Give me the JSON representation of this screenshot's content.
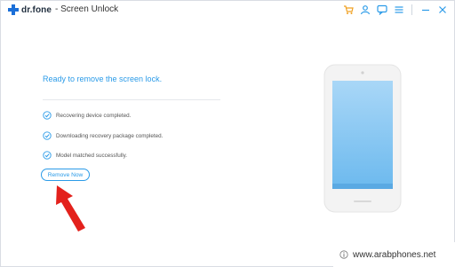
{
  "app": {
    "brand": "dr.fone",
    "module_title": "- Screen Unlock"
  },
  "toolbar": {
    "icons": [
      "cart-icon",
      "user-icon",
      "feedback-icon",
      "menu-icon",
      "minimize-icon",
      "close-icon"
    ]
  },
  "main": {
    "heading": "Ready to remove the screen lock.",
    "steps": [
      {
        "text": "Recovering device completed.",
        "status": "done"
      },
      {
        "text": "Downloading recovery package completed.",
        "status": "done"
      },
      {
        "text": "Model matched successfully.",
        "status": "done"
      }
    ],
    "remove_button_label": "Remove Now"
  },
  "watermark": {
    "text": "www.arabphones.net"
  },
  "colors": {
    "accent": "#2b9be8",
    "brand_blue": "#1b6fd8",
    "cart_orange": "#f0a020",
    "arrow_red": "#e3211c",
    "phone_body": "#f2f2f2",
    "phone_screen": "#8cc8f4"
  }
}
